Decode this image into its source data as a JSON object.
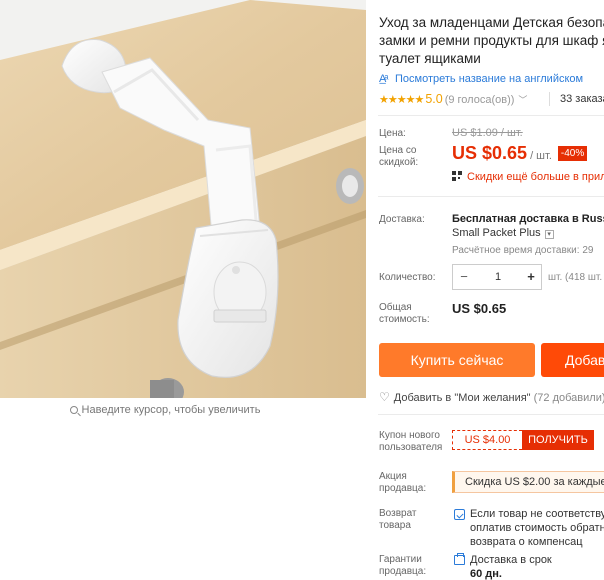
{
  "gallery": {
    "zoom_hint": "Наведите курсор, чтобы увеличить"
  },
  "product": {
    "title_lines": [
      "Уход за младенцами Детская безопас",
      "замки и ремни продукты для шкаф я",
      "туалет ящиками"
    ],
    "translate_link": "Посмотреть название на английском",
    "stars": "★★★★★",
    "rating_score": "5.0",
    "rating_votes": "(9 голоса(ов))",
    "orders": "33 заказа"
  },
  "price": {
    "label": "Цена:",
    "old": "US $1.09 / шт.",
    "discount_label": "Цена со скидкой:",
    "new": "US $0.65",
    "per_unit": "/ шт.",
    "discount_badge": "-40%",
    "more_discounts": "Скидки ещё больше в прил"
  },
  "shipping": {
    "label": "Доставка:",
    "main": "Бесплатная доставка в Russi",
    "method": "Small Packet Plus",
    "time": "Расчётное время доставки: 29"
  },
  "quantity": {
    "label": "Количество:",
    "minus": "−",
    "value": "1",
    "plus": "+",
    "available": "шт. (418 шт."
  },
  "total": {
    "label": "Общая стоимость:",
    "value": "US $0.65"
  },
  "actions": {
    "buy_now": "Купить сейчас",
    "add_to_cart": "Добав",
    "wishlist": "Добавить в \"Мои желания\"",
    "wishlist_count": "(72 добавили)"
  },
  "coupon": {
    "label": "Купон нового пользователя",
    "amount": "US $4.00",
    "get": "ПОЛУЧИТЬ"
  },
  "promo": {
    "label": "Акция продавца:",
    "text": "Скидка US $2.00 за каждые US"
  },
  "returns": {
    "label": "Возврат товара",
    "lines": [
      "Если товар не соответствуе",
      "оплатив стоимость обратн",
      "возврата о компенсац"
    ]
  },
  "guarantee": {
    "label": "Гарантии продавца:",
    "line1": "Доставка в срок",
    "line2": "60 дн."
  },
  "colors": {
    "price_red": "#e62e04",
    "buy_orange": "#ff7a2a",
    "cart_orange": "#ff4a07",
    "star_gold": "#f2a200",
    "link_blue": "#2b7bd9"
  }
}
